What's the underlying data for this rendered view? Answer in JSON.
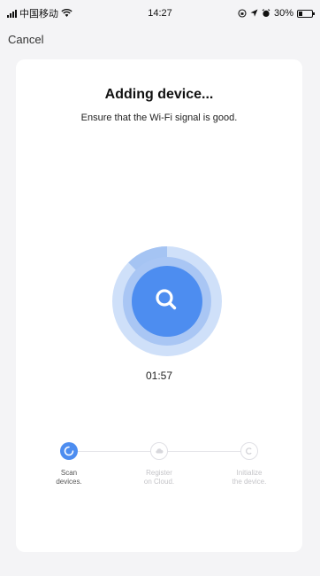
{
  "status_bar": {
    "carrier": "中国移动",
    "time": "14:27",
    "battery_percent": "30%",
    "battery_level": 0.3
  },
  "header": {
    "cancel_label": "Cancel"
  },
  "card": {
    "title": "Adding device...",
    "subtitle": "Ensure that the Wi-Fi signal is good.",
    "timer": "01:57",
    "icons": {
      "center": "search-icon",
      "step1": "loading-icon",
      "step2": "cloud-icon",
      "step3": "initialize-icon"
    },
    "colors": {
      "accent": "#4d8df0",
      "ring_outer": "#c9dcf8",
      "ring_mid": "#a9c7f4",
      "inactive": "#c4c4c8"
    },
    "steps": [
      {
        "line1": "Scan",
        "line2": "devices.",
        "state": "active"
      },
      {
        "line1": "Register",
        "line2": "on Cloud.",
        "state": "inactive"
      },
      {
        "line1": "Initialize",
        "line2": "the device.",
        "state": "inactive"
      }
    ]
  }
}
